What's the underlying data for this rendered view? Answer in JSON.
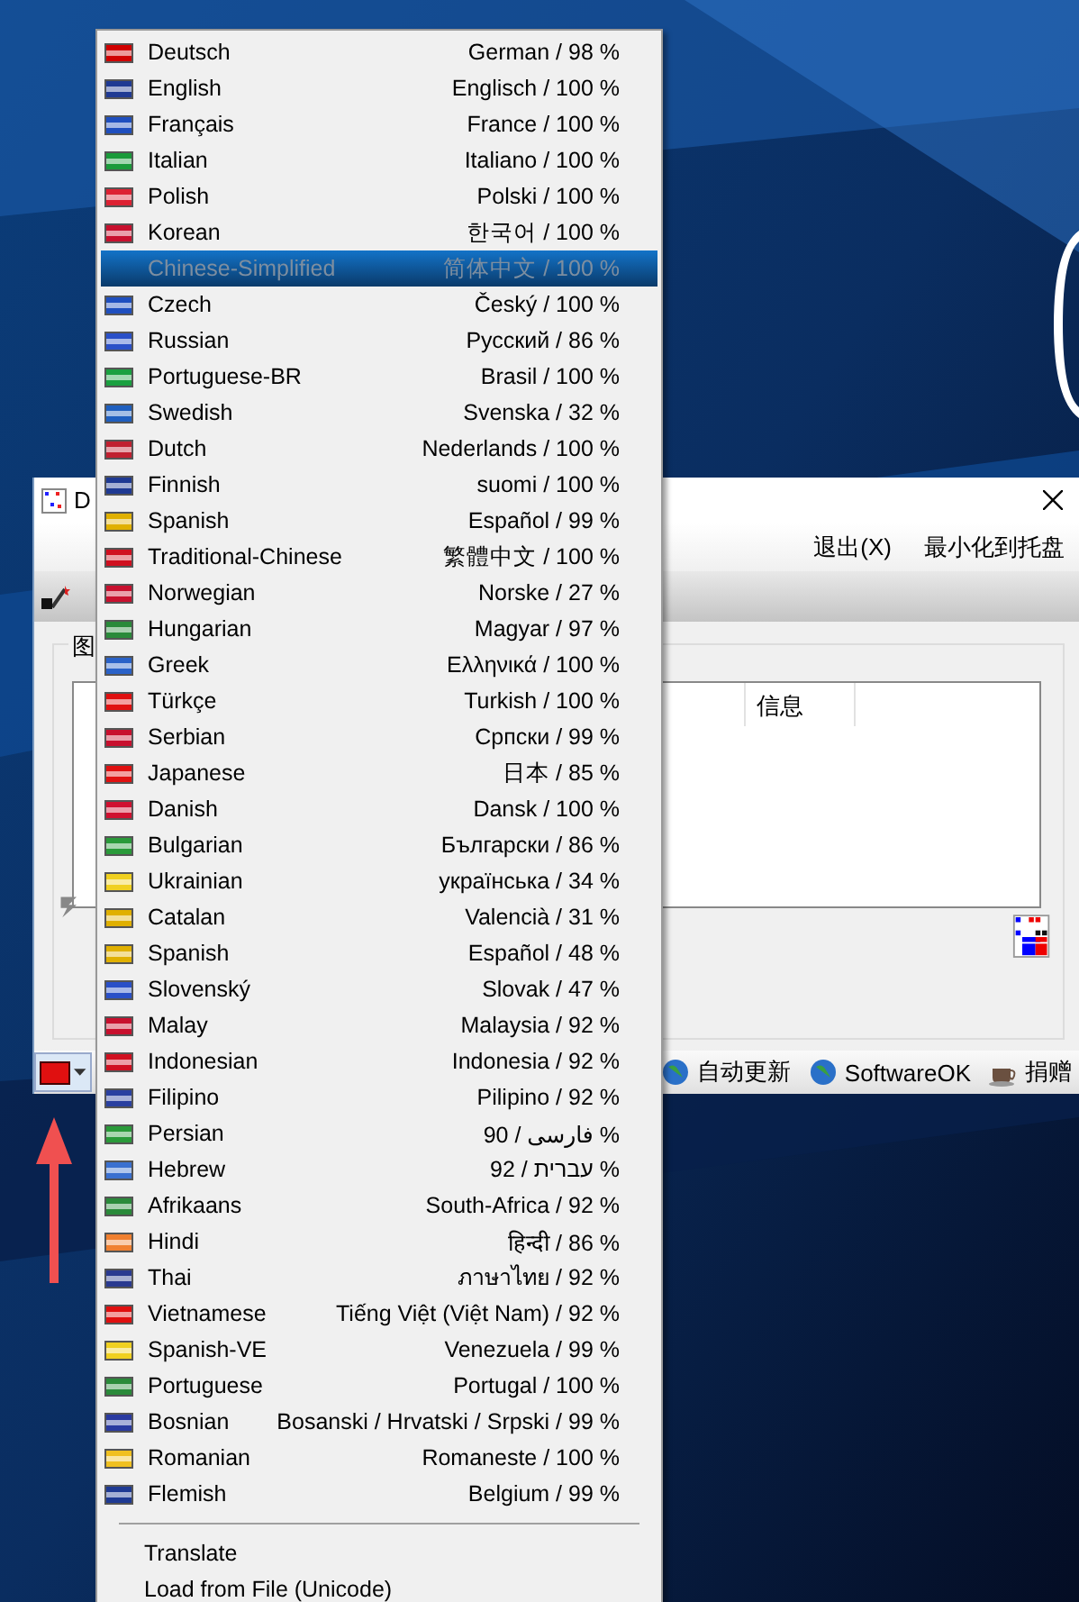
{
  "app_window": {
    "title": "D",
    "menu": [
      {
        "label": "退出(X)"
      },
      {
        "label": "最小化到托盘"
      }
    ],
    "group_title": "图",
    "list_columns": [
      "信息"
    ],
    "status_bar": [
      {
        "label": "自动更新"
      },
      {
        "label": "SoftwareOK"
      },
      {
        "label": "捐赠"
      }
    ]
  },
  "language_menu": {
    "items": [
      {
        "name": "Deutsch",
        "native": "German / 98 %",
        "selected": false,
        "color": "#d00000"
      },
      {
        "name": "English",
        "native": "Englisch / 100 %",
        "selected": false,
        "color": "#1f3a93"
      },
      {
        "name": "Français",
        "native": "France / 100 %",
        "selected": false,
        "color": "#1f4fbf"
      },
      {
        "name": "Italian",
        "native": "Italiano / 100 %",
        "selected": false,
        "color": "#1a9a3a"
      },
      {
        "name": "Polish",
        "native": "Polski / 100 %",
        "selected": false,
        "color": "#dd2233"
      },
      {
        "name": "Korean",
        "native": "한국어 / 100 %",
        "selected": false,
        "color": "#c8102e"
      },
      {
        "name": "Chinese-Simplified",
        "native": "简体中文 / 100 %",
        "selected": true
      },
      {
        "name": "Czech",
        "native": "Český  / 100 %",
        "selected": false,
        "color": "#1f4fbf"
      },
      {
        "name": "Russian",
        "native": "Русский  / 86 %",
        "selected": false,
        "color": "#2a50c8"
      },
      {
        "name": "Portuguese-BR",
        "native": "Brasil  / 100 %",
        "selected": false,
        "color": "#1aa040"
      },
      {
        "name": "Swedish",
        "native": "Svenska / 32 %",
        "selected": false,
        "color": "#1f5fbf"
      },
      {
        "name": "Dutch",
        "native": "Nederlands / 100 %",
        "selected": false,
        "color": "#c02030"
      },
      {
        "name": "Finnish",
        "native": "suomi / 100 %",
        "selected": false,
        "color": "#1f3a93"
      },
      {
        "name": "Spanish",
        "native": "Español / 99 %",
        "selected": false,
        "color": "#e0b000"
      },
      {
        "name": "Traditional-Chinese",
        "native": "繁體中文 / 100 %",
        "selected": false,
        "color": "#d01020"
      },
      {
        "name": "Norwegian",
        "native": "Norske / 27 %",
        "selected": false,
        "color": "#c8102e"
      },
      {
        "name": "Hungarian",
        "native": "Magyar / 97 %",
        "selected": false,
        "color": "#2a8a3a"
      },
      {
        "name": "Greek",
        "native": "Ελληνικά / 100 %",
        "selected": false,
        "color": "#2a62c8"
      },
      {
        "name": "Türkçe",
        "native": "Turkish / 100 %",
        "selected": false,
        "color": "#e01010"
      },
      {
        "name": "Serbian",
        "native": "Српски / 99 %",
        "selected": false,
        "color": "#c8102e"
      },
      {
        "name": "Japanese",
        "native": "日本 / 85 %",
        "selected": false,
        "color": "#e01010"
      },
      {
        "name": "Danish",
        "native": "Dansk / 100 %",
        "selected": false,
        "color": "#d01030"
      },
      {
        "name": "Bulgarian",
        "native": "Български / 86 %",
        "selected": false,
        "color": "#2a9a3a"
      },
      {
        "name": "Ukrainian",
        "native": "українська / 34 %",
        "selected": false,
        "color": "#f0d020"
      },
      {
        "name": "Catalan",
        "native": "Valencià / 31 %",
        "selected": false,
        "color": "#e0b000"
      },
      {
        "name": "Spanish",
        "native": "Español / 48 %",
        "selected": false,
        "color": "#e0b000"
      },
      {
        "name": "Slovenský",
        "native": "Slovak / 47 %",
        "selected": false,
        "color": "#2a50c8"
      },
      {
        "name": "Malay",
        "native": "Malaysia / 92 %",
        "selected": false,
        "color": "#c8102e"
      },
      {
        "name": "Indonesian",
        "native": "Indonesia / 92 %",
        "selected": false,
        "color": "#d01020"
      },
      {
        "name": "Filipino",
        "native": "Pilipino / 92 %",
        "selected": false,
        "color": "#2a40a0"
      },
      {
        "name": "Persian",
        "native": "فارسی / 90 %",
        "selected": false,
        "color": "#2a9a3a"
      },
      {
        "name": "Hebrew",
        "native": "עברית / 92 %",
        "selected": false,
        "color": "#3a70d0"
      },
      {
        "name": "Afrikaans",
        "native": "South-Africa / 92 %",
        "selected": false,
        "color": "#2a8a3a"
      },
      {
        "name": "Hindi",
        "native": "हिन्दी / 86 %",
        "selected": false,
        "color": "#f08030"
      },
      {
        "name": "Thai",
        "native": "ภาษาไทย / 92 %",
        "selected": false,
        "color": "#2a3a90"
      },
      {
        "name": "Vietnamese",
        "native": "Tiếng Việt (Việt Nam) / 92 %",
        "selected": false,
        "color": "#e01010"
      },
      {
        "name": "Spanish-VE",
        "native": "Venezuela / 99 %",
        "selected": false,
        "color": "#f0d020"
      },
      {
        "name": "Portuguese",
        "native": "Portugal / 100 %",
        "selected": false,
        "color": "#2a8a3a"
      },
      {
        "name": "Bosnian",
        "native": "Bosanski / Hrvatski / Srpski / 99 %",
        "selected": false,
        "color": "#2a3aa0"
      },
      {
        "name": "Romanian",
        "native": "Romaneste / 100 %",
        "selected": false,
        "color": "#f0c020"
      },
      {
        "name": "Flemish",
        "native": "Belgium / 99 %",
        "selected": false,
        "color": "#1f3a93"
      }
    ],
    "actions": [
      "Translate",
      "Load from File (Unicode)"
    ]
  }
}
